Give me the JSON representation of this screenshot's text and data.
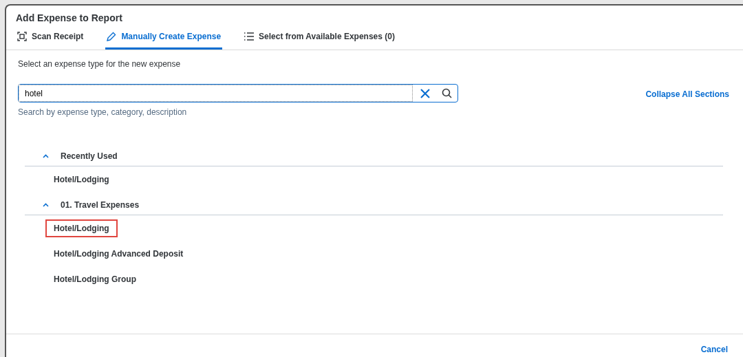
{
  "window": {
    "title": "Add Expense to Report"
  },
  "tabs": [
    {
      "label": "Scan Receipt",
      "kind": "scan",
      "selected": false
    },
    {
      "label": "Manually Create Expense",
      "kind": "pencil",
      "selected": true
    },
    {
      "label": "Select from Available Expenses (0)",
      "kind": "list",
      "selected": false
    }
  ],
  "instruction": "Select an expense type for the new expense",
  "search": {
    "value": "hotel",
    "helper": "Search by expense type, category, description"
  },
  "collapse_link": "Collapse All Sections",
  "sections": [
    {
      "title": "Recently Used",
      "expanded": true,
      "items": [
        {
          "label": "Hotel/Lodging",
          "highlighted": false
        }
      ]
    },
    {
      "title": "01. Travel Expenses",
      "expanded": true,
      "items": [
        {
          "label": "Hotel/Lodging",
          "highlighted": true
        },
        {
          "label": "Hotel/Lodging Advanced Deposit",
          "highlighted": false
        },
        {
          "label": "Hotel/Lodging Group",
          "highlighted": false
        }
      ]
    }
  ],
  "footer": {
    "cancel": "Cancel"
  }
}
